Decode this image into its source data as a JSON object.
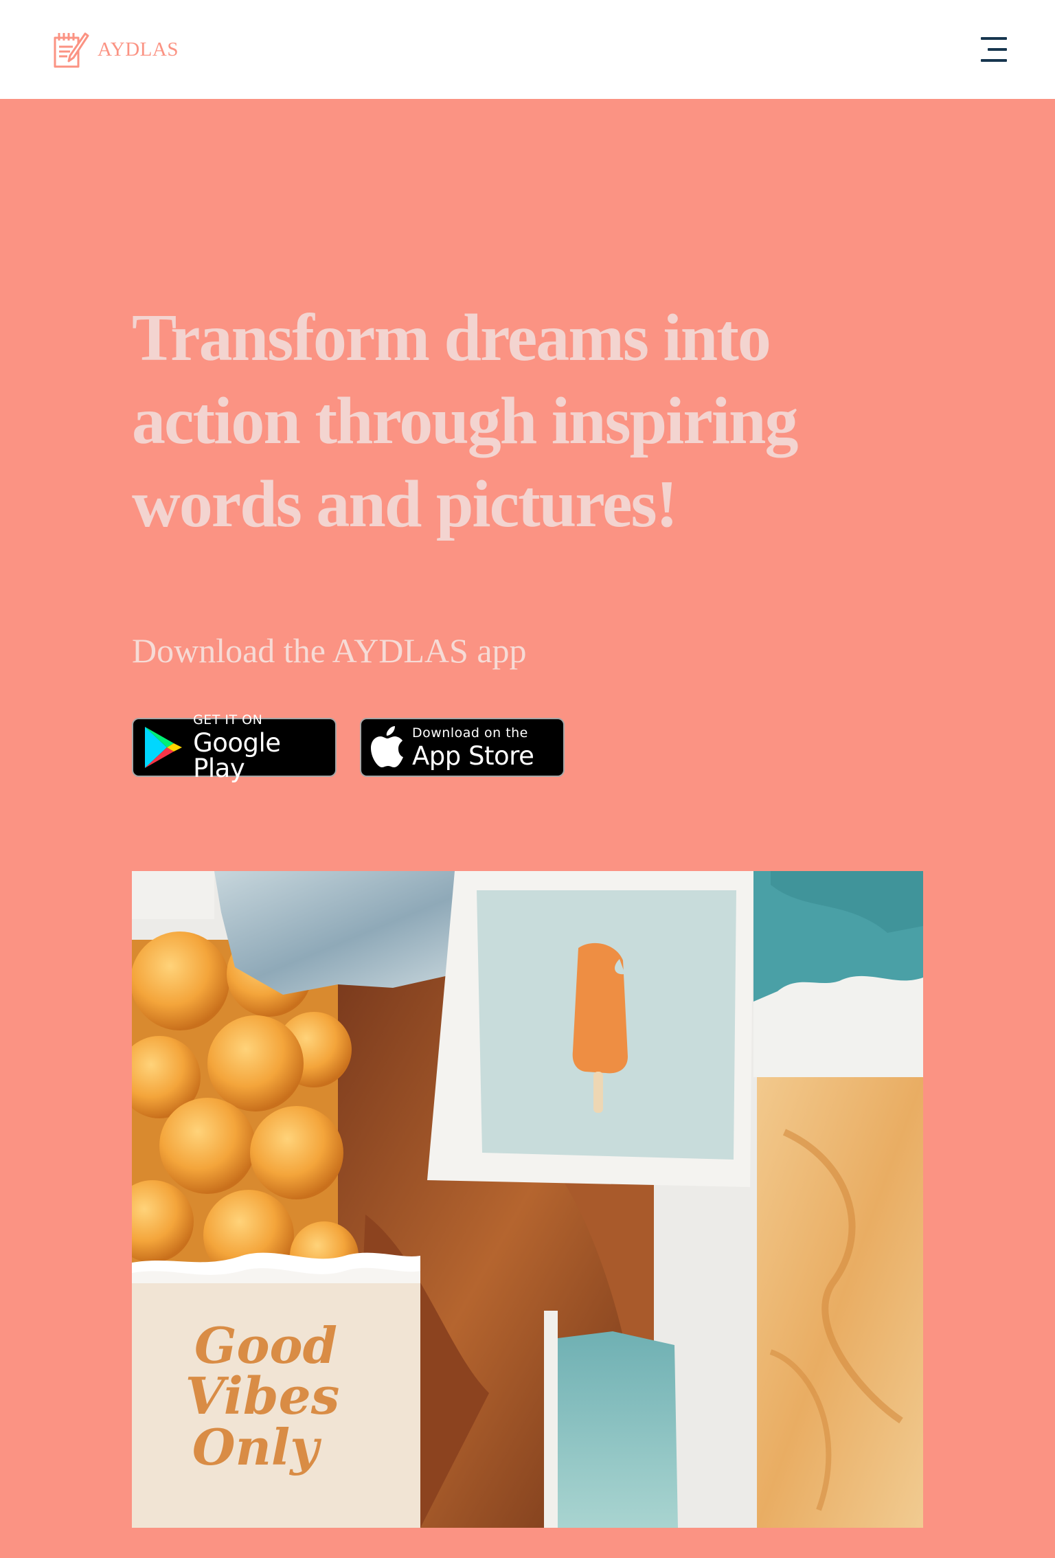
{
  "header": {
    "brand": "AYDLAS",
    "logo_icon": "notepad-pencil-icon",
    "menu_icon": "hamburger-menu-icon"
  },
  "hero": {
    "title": "Transform dreams into action through inspiring words and pictures!",
    "subtitle": "Download the AYDLAS app"
  },
  "badges": {
    "google": {
      "small": "GET IT ON",
      "big": "Google Play",
      "icon": "google-play-icon"
    },
    "apple": {
      "small": "Download on the",
      "big": "App Store",
      "icon": "apple-icon"
    }
  },
  "collage": {
    "lettering": [
      "Good",
      "Vibes",
      "Only"
    ]
  },
  "colors": {
    "background": "#fb9383",
    "header_bg": "#ffffff",
    "brand": "#fb9383",
    "title_text": "#f3d4d0",
    "menu_icon": "#17364f",
    "badge_bg": "#000000"
  }
}
